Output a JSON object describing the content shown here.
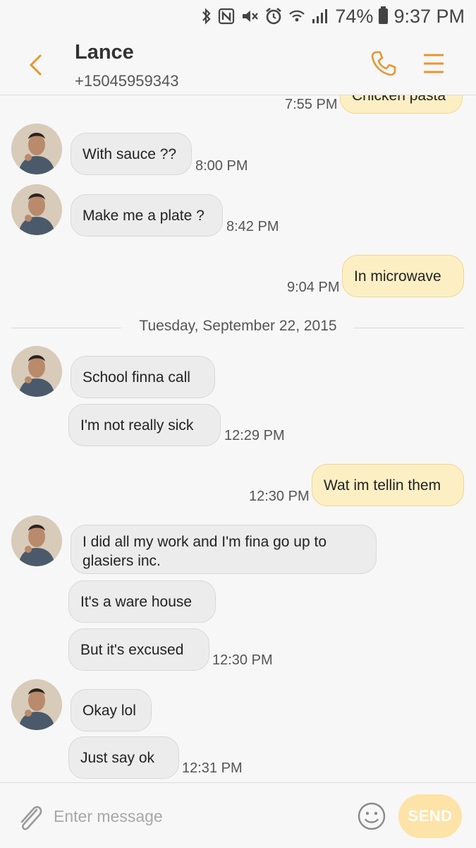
{
  "status_bar": {
    "battery": "74%",
    "time": "9:37 PM",
    "icons": [
      "bluetooth-icon",
      "nfc-icon",
      "mute-icon",
      "alarm-icon",
      "wifi-icon",
      "signal-icon",
      "battery-icon"
    ]
  },
  "header": {
    "contact_name": "Lance",
    "contact_number": "+15045959343",
    "icons": [
      "back-arrow-icon",
      "phone-icon",
      "menu-icon"
    ],
    "accent_color": "#e8962e"
  },
  "messages": [
    {
      "dir": "out",
      "text": "Chicken pasta",
      "time": "7:55 PM"
    },
    {
      "dir": "in",
      "text": "With sauce ??",
      "time": "8:00 PM"
    },
    {
      "dir": "in",
      "text": "Make me a plate ?",
      "time": "8:42 PM"
    },
    {
      "dir": "out",
      "text": "In microwave",
      "time": "9:04 PM"
    },
    {
      "dir": "in",
      "text": "School finna call",
      "time": ""
    },
    {
      "dir": "in",
      "text": "I'm not really sick",
      "time": "12:29 PM"
    },
    {
      "dir": "out",
      "text": "Wat im tellin them",
      "time": "12:30 PM"
    },
    {
      "dir": "in",
      "text": "I did all my work and I'm fina go up to glasiers inc.",
      "time": ""
    },
    {
      "dir": "in",
      "text": "It's a ware house",
      "time": ""
    },
    {
      "dir": "in",
      "text": "But it's excused",
      "time": "12:30 PM"
    },
    {
      "dir": "in",
      "text": "Okay lol",
      "time": ""
    },
    {
      "dir": "in",
      "text": "Just say ok",
      "time": "12:31 PM"
    }
  ],
  "date_separator": "Tuesday, September 22, 2015",
  "composer": {
    "placeholder": "Enter message",
    "value": "",
    "send_label": "SEND",
    "icons": [
      "paperclip-icon",
      "emoji-icon"
    ]
  },
  "colors": {
    "incoming_bubble": "#ececec",
    "outgoing_bubble": "#fdefc4",
    "send_button": "#fde3a7"
  }
}
